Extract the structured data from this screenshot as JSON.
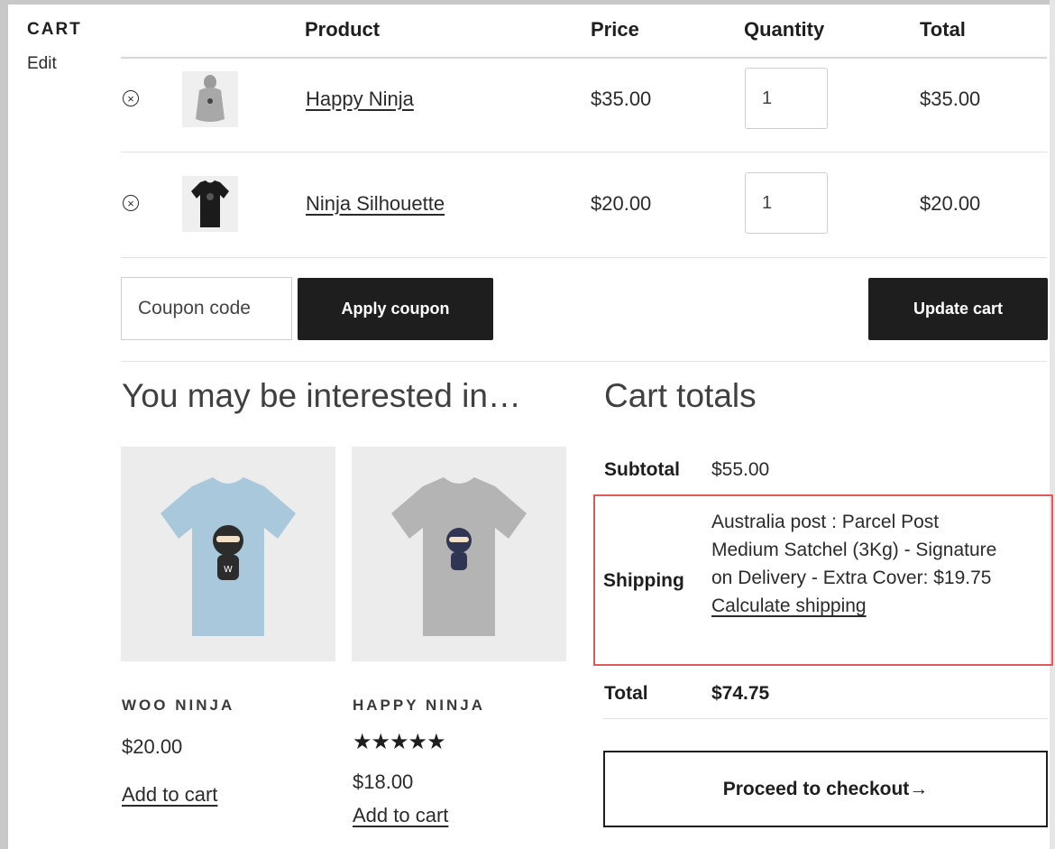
{
  "sidebar": {
    "title": "CART",
    "edit_label": "Edit"
  },
  "table": {
    "headers": {
      "product": "Product",
      "price": "Price",
      "quantity": "Quantity",
      "total": "Total"
    },
    "rows": [
      {
        "name": "Happy Ninja",
        "price": "$35.00",
        "quantity": "1",
        "total": "$35.00",
        "image": "hoodie-thumbnail",
        "remove_icon": "remove-circle-x-icon"
      },
      {
        "name": "Ninja Silhouette",
        "price": "$20.00",
        "quantity": "1",
        "total": "$20.00",
        "image": "black-tshirt-thumbnail",
        "remove_icon": "remove-circle-x-icon"
      }
    ]
  },
  "actions": {
    "coupon_placeholder": "Coupon code",
    "apply_coupon_label": "Apply coupon",
    "update_cart_label": "Update cart"
  },
  "cross_sells": {
    "title": "You may be interested in…",
    "products": [
      {
        "name": "WOO NINJA",
        "price": "$20.00",
        "add_label": "Add to cart",
        "rating": null,
        "image": "blue-ninja-tshirt"
      },
      {
        "name": "HAPPY NINJA",
        "price": "$18.00",
        "add_label": "Add to cart",
        "rating": 5,
        "image": "grey-ninja-tshirt"
      }
    ]
  },
  "totals": {
    "title": "Cart totals",
    "subtotal_label": "Subtotal",
    "subtotal_value": "$55.00",
    "shipping_label": "Shipping",
    "shipping_line1": "Australia post : Parcel Post",
    "shipping_line2": "Medium Satchel (3Kg) - Signature",
    "shipping_line3": "on Delivery - Extra Cover: $19.75",
    "calculate_shipping_label": "Calculate shipping",
    "total_label": "Total",
    "total_value": "$74.75",
    "checkout_label": "Proceed to checkout→"
  },
  "colors": {
    "button_dark": "#1e1e1e",
    "highlight_border": "#e05a5a",
    "product_bg": "#ececec"
  }
}
